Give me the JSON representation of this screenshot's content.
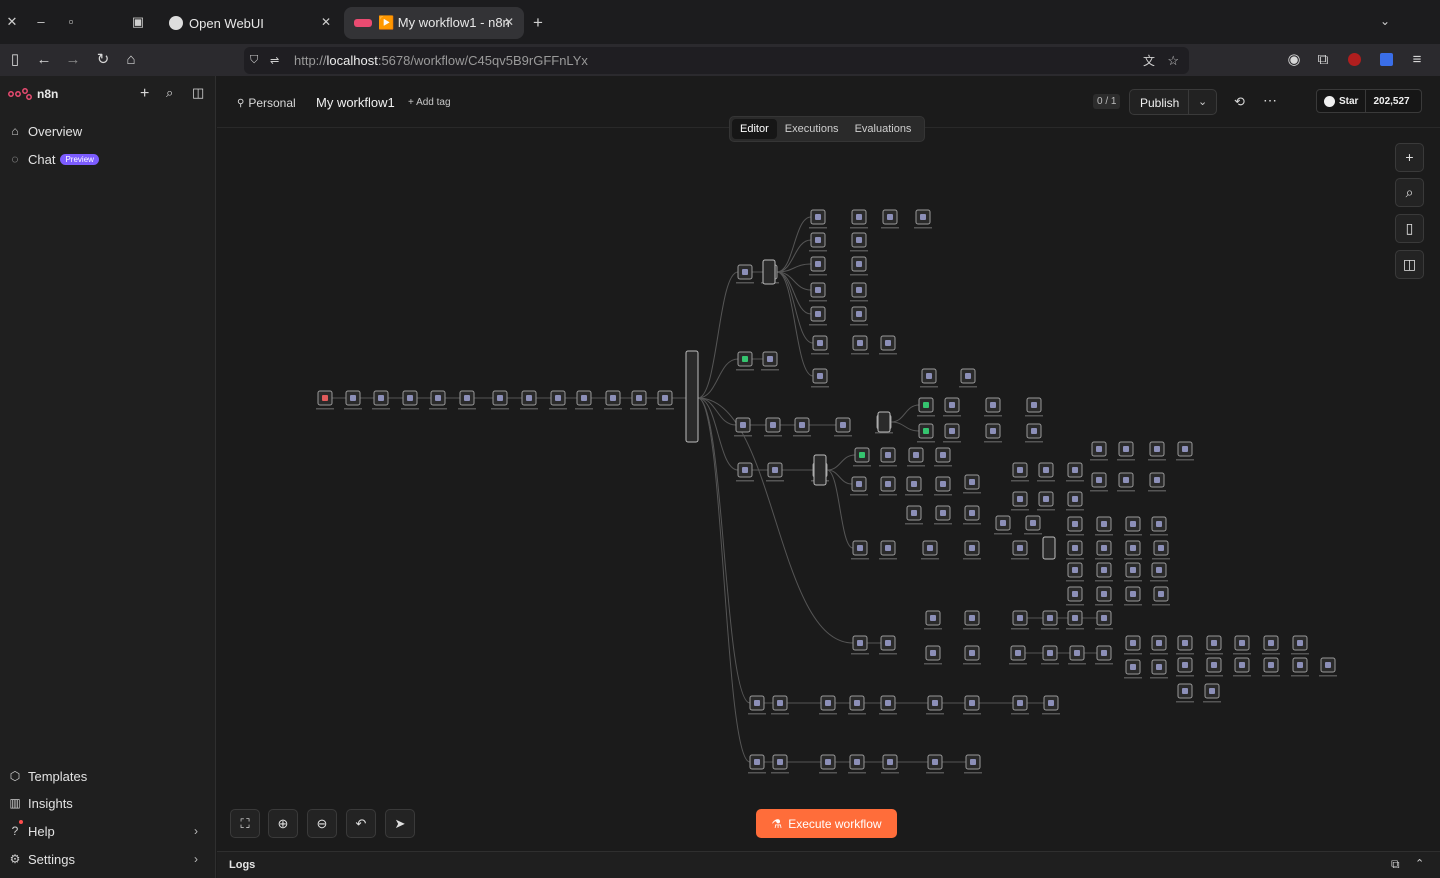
{
  "browser": {
    "tabs": [
      {
        "title": "Open WebUI",
        "active": false
      },
      {
        "title": "▶️ My workflow1 - n8n",
        "active": true
      }
    ],
    "url": {
      "scheme": "http://",
      "host": "localhost",
      "rest": ":5678/workflow/C45qv5B9rGFFnLYx"
    }
  },
  "sidebar": {
    "brand": "n8n",
    "top_items": [
      {
        "label": "Overview",
        "icon": "home-icon"
      },
      {
        "label": "Chat",
        "icon": "chat-icon",
        "badge": "Preview"
      }
    ],
    "bottom_items": [
      {
        "label": "Templates",
        "icon": "templates-icon"
      },
      {
        "label": "Insights",
        "icon": "insights-icon"
      },
      {
        "label": "Help",
        "icon": "help-icon"
      },
      {
        "label": "Settings",
        "icon": "settings-icon"
      }
    ]
  },
  "header": {
    "project": "Personal",
    "workflow_name": "My workflow1",
    "add_tag": "+ Add tag",
    "version_counter": "0 / 1",
    "publish_label": "Publish",
    "star_label": "Star",
    "star_count": "202,527"
  },
  "view_tabs": {
    "editor": "Editor",
    "executions": "Executions",
    "evaluations": "Evaluations"
  },
  "canvas": {
    "execute_label": "Execute workflow",
    "colors": {
      "accent": "#ff6d3a",
      "node_border": "#9a9a9a",
      "node_fill": "#2a2a2a",
      "edge": "#555555",
      "trigger": "#e05b5b",
      "success": "#35c46f"
    }
  },
  "logs": {
    "label": "Logs"
  }
}
